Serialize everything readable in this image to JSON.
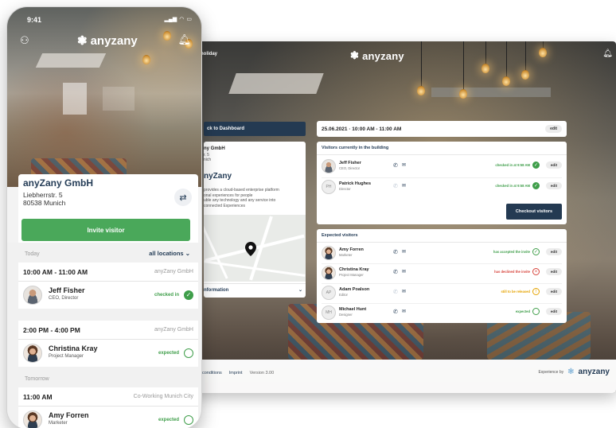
{
  "colors": {
    "navy": "#243a52",
    "green": "#4aa85a",
    "status_green": "#3f9e4a",
    "status_red": "#d7433b",
    "status_orange": "#e5a300"
  },
  "tablet": {
    "brand": "anyzany",
    "holiday": "holiday",
    "back_button": "ck to Dashboard",
    "location": {
      "name": "ny GmbH",
      "address": "r. 5\nnich",
      "title": "nyZany",
      "description": "provides a cloud-based enterprise platform\nonal experiences for people\nuble any technology and any service into\nconnected Experiences",
      "info_label": "nformation"
    },
    "time_slot": {
      "label": "25.06.2021 · 10:00 AM - 11:00 AM",
      "edit": "edit"
    },
    "in_building": {
      "title": "Visitors currently in the building",
      "visitors": [
        {
          "name": "Jeff Fisher",
          "role": "CEO, Director",
          "status": "checked in at 9:58 AM",
          "edit": "edit",
          "initials": ""
        },
        {
          "name": "Patrick Hughes",
          "role": "Director",
          "status": "checked in at 9:58 AM",
          "edit": "edit",
          "initials": "PH"
        }
      ],
      "checkout_button": "Checkout visitors"
    },
    "expected": {
      "title": "Expected visitors",
      "visitors": [
        {
          "name": "Amy Forren",
          "role": "Marketer",
          "status": "has accepted the invite",
          "edit": "edit",
          "initials": ""
        },
        {
          "name": "Christina Kray",
          "role": "Project Manager",
          "status": "has declined the invite",
          "edit": "edit",
          "initials": ""
        },
        {
          "name": "Adam Poalson",
          "role": "Editor",
          "status": "still to be released",
          "edit": "edit",
          "initials": "AP"
        },
        {
          "name": "Michael Hunt",
          "role": "Designer",
          "status": "expected",
          "edit": "edit",
          "initials": "MH"
        }
      ]
    },
    "footer": {
      "conditions": "conditions",
      "imprint": "Imprint",
      "version": "Version 3.00",
      "experience_by": "Experience by",
      "logo": "anyzany"
    }
  },
  "phone": {
    "status_time": "9:41",
    "brand": "anyzany",
    "company": "anyZany GmbH",
    "address_line1": "Liebherrstr. 5",
    "address_line2": "80538 Munich",
    "invite_button": "Invite visitor",
    "today_label": "Today",
    "all_locations": "all locations",
    "tomorrow_label": "Tomorrow",
    "slots": [
      {
        "time": "10:00 AM - 11:00 AM",
        "location": "anyZany GmbH",
        "visitor": "Jeff Fisher",
        "role": "CEO, Director",
        "status": "checked in"
      },
      {
        "time": "2:00 PM - 4:00 PM",
        "location": "anyZany GmbH",
        "visitor": "Christina Kray",
        "role": "Project Manager",
        "status": "expected"
      },
      {
        "time": "11:00 AM",
        "location": "Co-Working Munich City",
        "visitor": "Amy Forren",
        "role": "Marketer",
        "status": "expected"
      }
    ]
  }
}
